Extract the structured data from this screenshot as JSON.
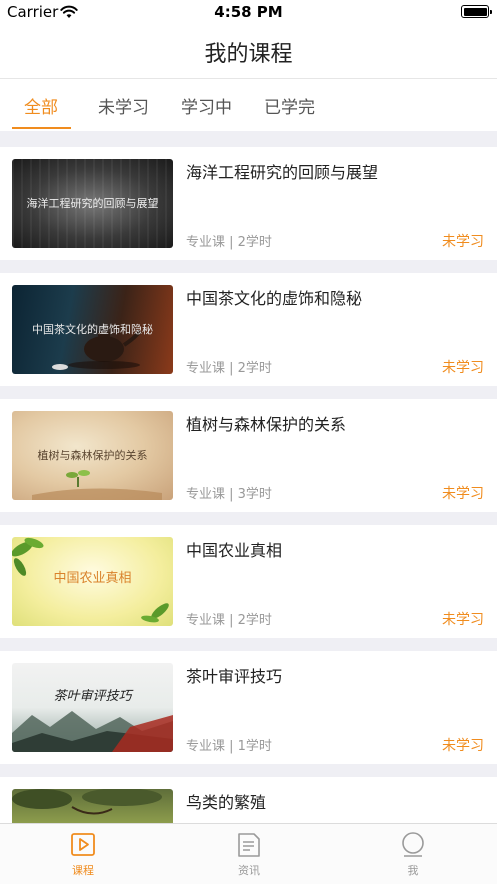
{
  "status_bar": {
    "carrier": "Carrier",
    "time": "4:58 PM"
  },
  "nav": {
    "title": "我的课程"
  },
  "filter_tabs": [
    {
      "label": "全部",
      "active": true
    },
    {
      "label": "未学习",
      "active": false
    },
    {
      "label": "学习中",
      "active": false
    },
    {
      "label": "已学完",
      "active": false
    }
  ],
  "courses": [
    {
      "title": "海洋工程研究的回顾与展望",
      "thumb_text": "海洋工程研究的回顾与展望",
      "meta": "专业课 | 2学时",
      "status": "未学习"
    },
    {
      "title": "中国茶文化的虚饰和隐秘",
      "thumb_text": "中国茶文化的虚饰和隐秘",
      "meta": "专业课 | 2学时",
      "status": "未学习"
    },
    {
      "title": "植树与森林保护的关系",
      "thumb_text": "植树与森林保护的关系",
      "meta": "专业课 | 3学时",
      "status": "未学习"
    },
    {
      "title": "中国农业真相",
      "thumb_text": "中国农业真相",
      "meta": "专业课 | 2学时",
      "status": "未学习"
    },
    {
      "title": "茶叶审评技巧",
      "thumb_text": "茶叶审评技巧",
      "meta": "专业课 | 1学时",
      "status": "未学习"
    },
    {
      "title": "鸟类的繁殖",
      "thumb_text": "",
      "meta": "",
      "status": ""
    }
  ],
  "tab_bar": [
    {
      "label": "课程",
      "icon": "play-icon",
      "active": true
    },
    {
      "label": "资讯",
      "icon": "document-icon",
      "active": false
    },
    {
      "label": "我",
      "icon": "profile-icon",
      "active": false
    }
  ],
  "colors": {
    "accent": "#f08c1e",
    "background": "#efeff4"
  }
}
